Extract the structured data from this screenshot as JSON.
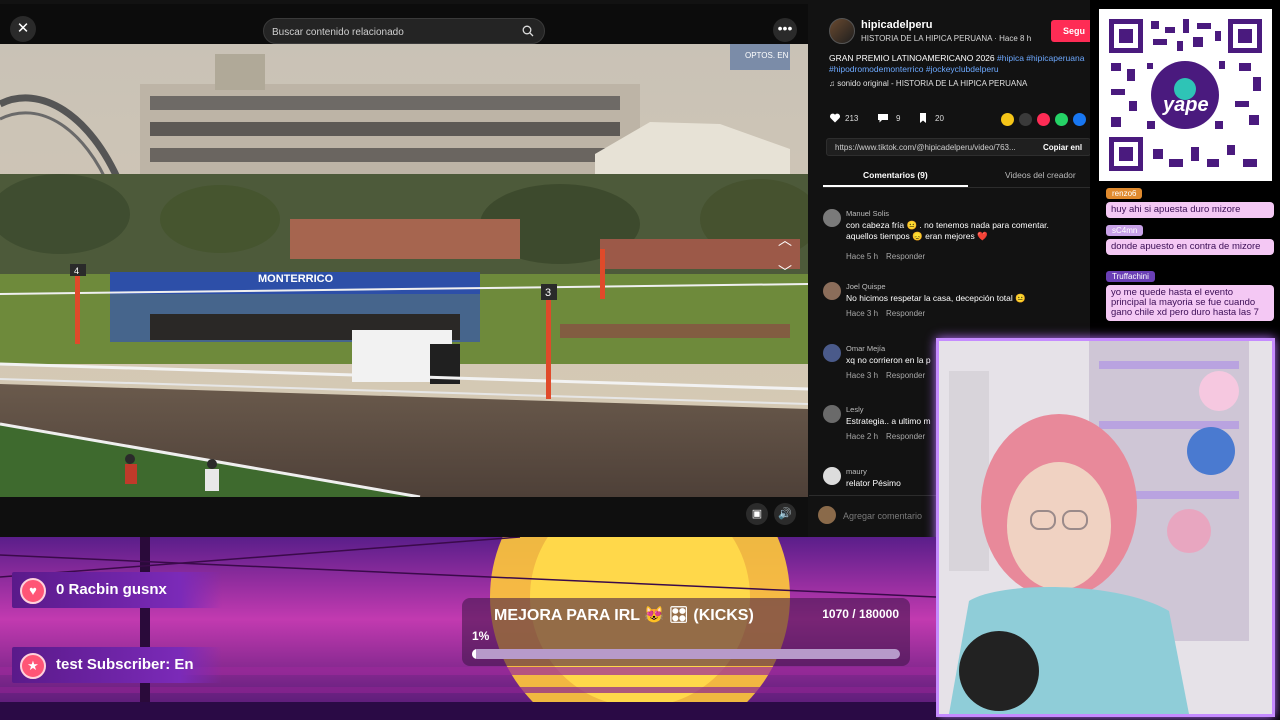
{
  "topbar": {
    "close_label": "✕",
    "search_placeholder": "Buscar contenido relacionado",
    "more_label": "•••"
  },
  "video": {
    "sign_text": "MONTERRICO",
    "post_number_4": "4",
    "post_number_3": "3",
    "ad_text": "OPTOS. EN"
  },
  "author": {
    "name": "hipicadelperu",
    "subtitle": "HISTORIA DE LA HIPICA PERUANA · Hace 8 h",
    "follow_label": "Segu"
  },
  "description": {
    "text": "GRAN PREMIO LATINOAMERICANO 2026 ",
    "tags_1": "#hipica #hipicaperuana",
    "tags_2": "#hipodromodemonterrico #jockeyclubdelperu"
  },
  "sound": "♫  sonido original - HISTORIA DE LA HIPICA PERUANA",
  "stats": {
    "likes": "213",
    "comments": "9",
    "saves": "20"
  },
  "url": {
    "text": "https://www.tiktok.com/@hipicadelperu/video/763...",
    "copy_label": "Copiar enl"
  },
  "tabs": {
    "comments": "Comentarios (9)",
    "creator_videos": "Videos del creador"
  },
  "comments": [
    {
      "user": "Manuel Solis",
      "text": "con cabeza fría 😐 . no tenemos nada para comentar.\naquellos tiempos 😞 eran mejores ❤️",
      "time": "Hace 5 h",
      "reply": "Responder"
    },
    {
      "user": "Joel Quispe",
      "text": "No hicimos respetar la casa, decepción total 😐",
      "time": "Hace 3 h",
      "reply": "Responder"
    },
    {
      "user": "Omar Mejía",
      "text": "xq no corrieron en la p",
      "time": "Hace 3 h",
      "reply": "Responder"
    },
    {
      "user": "Lesly",
      "text": "Estrategia.. a ultimo m",
      "time": "Hace 2 h",
      "reply": "Responder"
    },
    {
      "user": "maury",
      "text": "relator Pésimo",
      "time": "",
      "reply": ""
    }
  ],
  "add_comment_placeholder": "Agregar comentario",
  "qr": {
    "brand": "yape"
  },
  "chat": [
    {
      "name": "renzo6",
      "text": "huy ahi si apuesta duro mizore",
      "name_color": "#e08a2e"
    },
    {
      "name": "sC4mn",
      "text": "donde apuesto en contra de mizore",
      "name_color": "#c9a2e8"
    },
    {
      "name": "Truffachini",
      "text": "yo me quede hasta el evento principal la mayoria se fue cuando gano chile xd pero duro hasta las 7",
      "name_color": "#6a3fb5"
    }
  ],
  "overlay": {
    "ticker_1": "0    Racbin    gusnx",
    "ticker_2": "test Subscriber: En",
    "goal_title": "MEJORA PARA IRL 😻 🎛 (KICKS)",
    "goal_count": "1070 / 180000",
    "goal_percent": "1%",
    "goal_fraction": 0.01
  },
  "colors": {
    "accent_red": "#fe2c55",
    "tag_blue": "#6da9ff",
    "cam_border": "#c58bff"
  }
}
